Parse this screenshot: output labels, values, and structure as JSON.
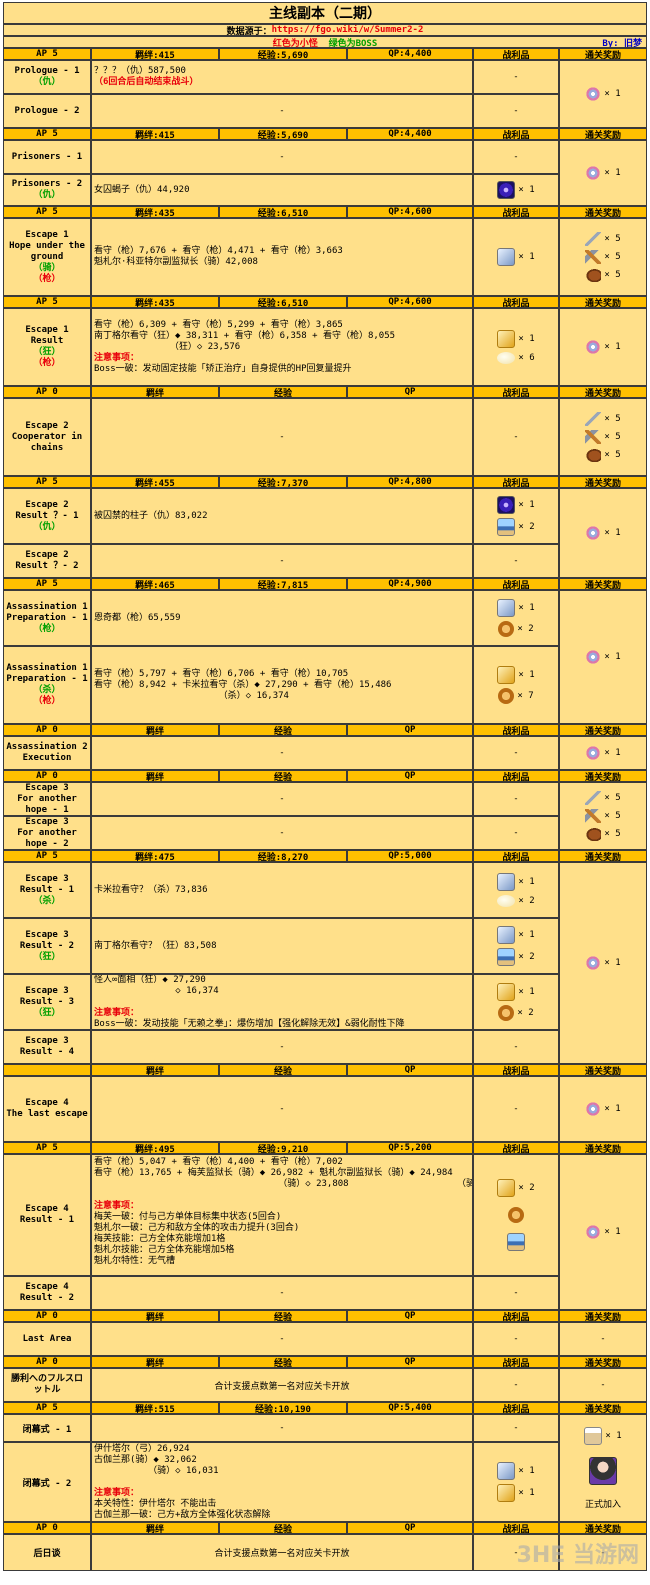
{
  "title": "主线副本（二期）",
  "source": {
    "label": "数据源于：",
    "url": "https://fgo.wiki/w/Summer2-2"
  },
  "legend": {
    "red_part": "红色为小怪",
    "green_part": "绿色为BOSS",
    "by": "By: 旧梦"
  },
  "headers": {
    "h5": {
      "ap": "AP 5",
      "bond": "羁绊:415",
      "exp": "经验:5,690",
      "qp": "QP:4,400",
      "drop": "战利品",
      "reward": "通关奖励"
    },
    "h5b": {
      "ap": "AP 5",
      "bond": "羁绊:435",
      "exp": "经验:6,510",
      "qp": "QP:4,600"
    },
    "h5c": {
      "ap": "AP 5",
      "bond": "羁绊:455",
      "exp": "经验:7,370",
      "qp": "QP:4,800"
    },
    "h5d": {
      "ap": "AP 5",
      "bond": "羁绊:465",
      "exp": "经验:7,815",
      "qp": "QP:4,900"
    },
    "h5e": {
      "ap": "AP 5",
      "bond": "羁绊:475",
      "exp": "经验:8,270",
      "qp": "QP:5,000"
    },
    "h5f": {
      "ap": "AP 5",
      "bond": "羁绊:495",
      "exp": "经验:9,210",
      "qp": "QP:5,200"
    },
    "h5g": {
      "ap": "AP 5",
      "bond": "羁绊:515",
      "exp": "经验:10,190",
      "qp": "QP:5,400"
    },
    "h0": {
      "ap": "AP 0",
      "bond": "羁绊",
      "exp": "经验",
      "qp": "QP"
    }
  },
  "common": {
    "dash": "-",
    "x1": "× 1",
    "x2": "× 2",
    "x5": "× 5",
    "x6": "× 6",
    "x7": "× 7",
    "note": "注意事项：",
    "join": "正式加入"
  },
  "quests": {
    "p1": {
      "name": "Prologue - 1",
      "cls": "（仇）",
      "line1": "？？？（仇）587,500",
      "line2": "（6回合后自动结束战斗）"
    },
    "p2": {
      "name": "Prologue - 2"
    },
    "pr1": {
      "name": "Prisoners - 1"
    },
    "pr2": {
      "name": "Prisoners - 2",
      "cls": "（仇）",
      "line1": "女囚蝎子（仇）44,920"
    },
    "e1a": {
      "name1": "Escape 1",
      "name2": "Hope under the",
      "name3": "ground",
      "cls1": "（骑）",
      "cls2": "（枪）",
      "line1": "看守（枪）7,676 + 看守（枪）4,471 + 看守（枪）3,663",
      "line2": "魁札尔·科亚特尔副监狱长（骑）42,008"
    },
    "e1b": {
      "name1": "Escape 1",
      "name2": "Result",
      "cls1": "（狂）",
      "cls2": "（枪）",
      "line1": "看守（枪）6,309 + 看守（枪）5,299 + 看守（枪）3,865",
      "line2": "南丁格尔看守（狂）◆ 38,311 + 看守（枪）6,358 + 看守（枪）8,055",
      "line3": "              （狂）◇ 23,576",
      "boss": "Boss一破：发动固定技能「矫正治疗」自身提供的HP回复量提升"
    },
    "e2a": {
      "name1": "Escape 2",
      "name2": "Cooperator in",
      "name3": "chains"
    },
    "e2b": {
      "name1": "Escape 2",
      "name2": "Result ？- 1",
      "cls": "（仇）",
      "line1": "被囚禁的柱子（仇）83,022"
    },
    "e2c": {
      "name1": "Escape 2",
      "name2": "Result ？- 2"
    },
    "a1": {
      "name1": "Assassination 1",
      "name2": "Preparation - 1",
      "cls": "（枪）",
      "line1": "恩奇都（枪）65,559"
    },
    "a2": {
      "name1": "Assassination 1",
      "name2": "Preparation - 1",
      "cls1": "（杀）",
      "cls2": "（枪）",
      "line1": "看守（枪）5,797 + 看守（枪）6,706 + 看守（枪）10,705",
      "line2": "看守（枪）8,942 + 卡米拉看守（杀）◆ 27,290 + 看守（枪）15,486",
      "line3": "                       （杀）◇ 16,374"
    },
    "a3": {
      "name1": "Assassination 2",
      "name2": "Execution"
    },
    "e3a": {
      "name1": "Escape 3",
      "name2": "For another",
      "name3": "hope - 1"
    },
    "e3b": {
      "name1": "Escape 3",
      "name2": "For another",
      "name3": "hope - 2"
    },
    "e3c": {
      "name1": "Escape 3",
      "name2": "Result - 1",
      "cls": "（杀）",
      "line1": "卡米拉看守？（杀）73,836"
    },
    "e3d": {
      "name1": "Escape 3",
      "name2": "Result - 2",
      "cls": "（狂）",
      "line1": "南丁格尔看守？（狂）83,508"
    },
    "e3e": {
      "name1": "Escape 3",
      "name2": "Result - 3",
      "cls": "（狂）",
      "line1": "怪人∞面相（狂）◆ 27,290",
      "line2": "               ◇ 16,374",
      "boss": "Boss一破：发动技能「无赖之拳」：爆伤增加【强化解除无效】&弱化耐性下降"
    },
    "e3f": {
      "name1": "Escape 3",
      "name2": "Result - 4"
    },
    "e4a": {
      "name1": "Escape 4",
      "name2": "The last escape"
    },
    "e4b": {
      "name1": "Escape 4",
      "name2": "Result - 1",
      "line1": "看守（枪）5,047 + 看守（枪）4,400 + 看守（枪）7,002",
      "line2": "看守（枪）13,765 + 梅芙监狱长（骑）◆ 26,982 + 魁札尔副监狱长（骑）◆ 24,984",
      "line3": "                                  （骑）◇ 23,808                    （骑）◇ 18,738",
      "b1": "梅芙一破：付与己方单体目标集中状态(5回合)",
      "b2": "魁札尔一破：己方和敌方全体的攻击力提升(3回合)",
      "b3": "梅芙技能：己方全体充能增加1格",
      "b4": "魁札尔技能：己方全体充能增加5格",
      "b5": "魁札尔特性：无气槽"
    },
    "e4c": {
      "name1": "Escape 4",
      "name2": "Result - 2"
    },
    "la": {
      "name": "Last Area"
    },
    "sl": {
      "name1": "勝利へのフルスロ",
      "name2": "ットル",
      "text": "合计支援点数第一名对应关卡开放"
    },
    "c1": {
      "name": "闭幕式 - 1"
    },
    "c2": {
      "name": "闭幕式 - 2",
      "line1": "伊什塔尔（弓）26,924",
      "line2": "古伽兰那(骑）◆ 32,062",
      "line3": "          （骑）◇ 16,031",
      "b1": "本关特性：伊什塔尔 不能出击",
      "b2": "古伽兰那一破：己方+敌方全体强化状态解除"
    },
    "hr": {
      "name": "后日谈",
      "text": "合计支援点数第一名对应关卡开放"
    }
  },
  "watermark": "3HE 当游网",
  "colors": {
    "header": "#ffc000",
    "row": "#ffe08a",
    "enemy_minor": "#e8000b",
    "boss": "#00a000"
  }
}
